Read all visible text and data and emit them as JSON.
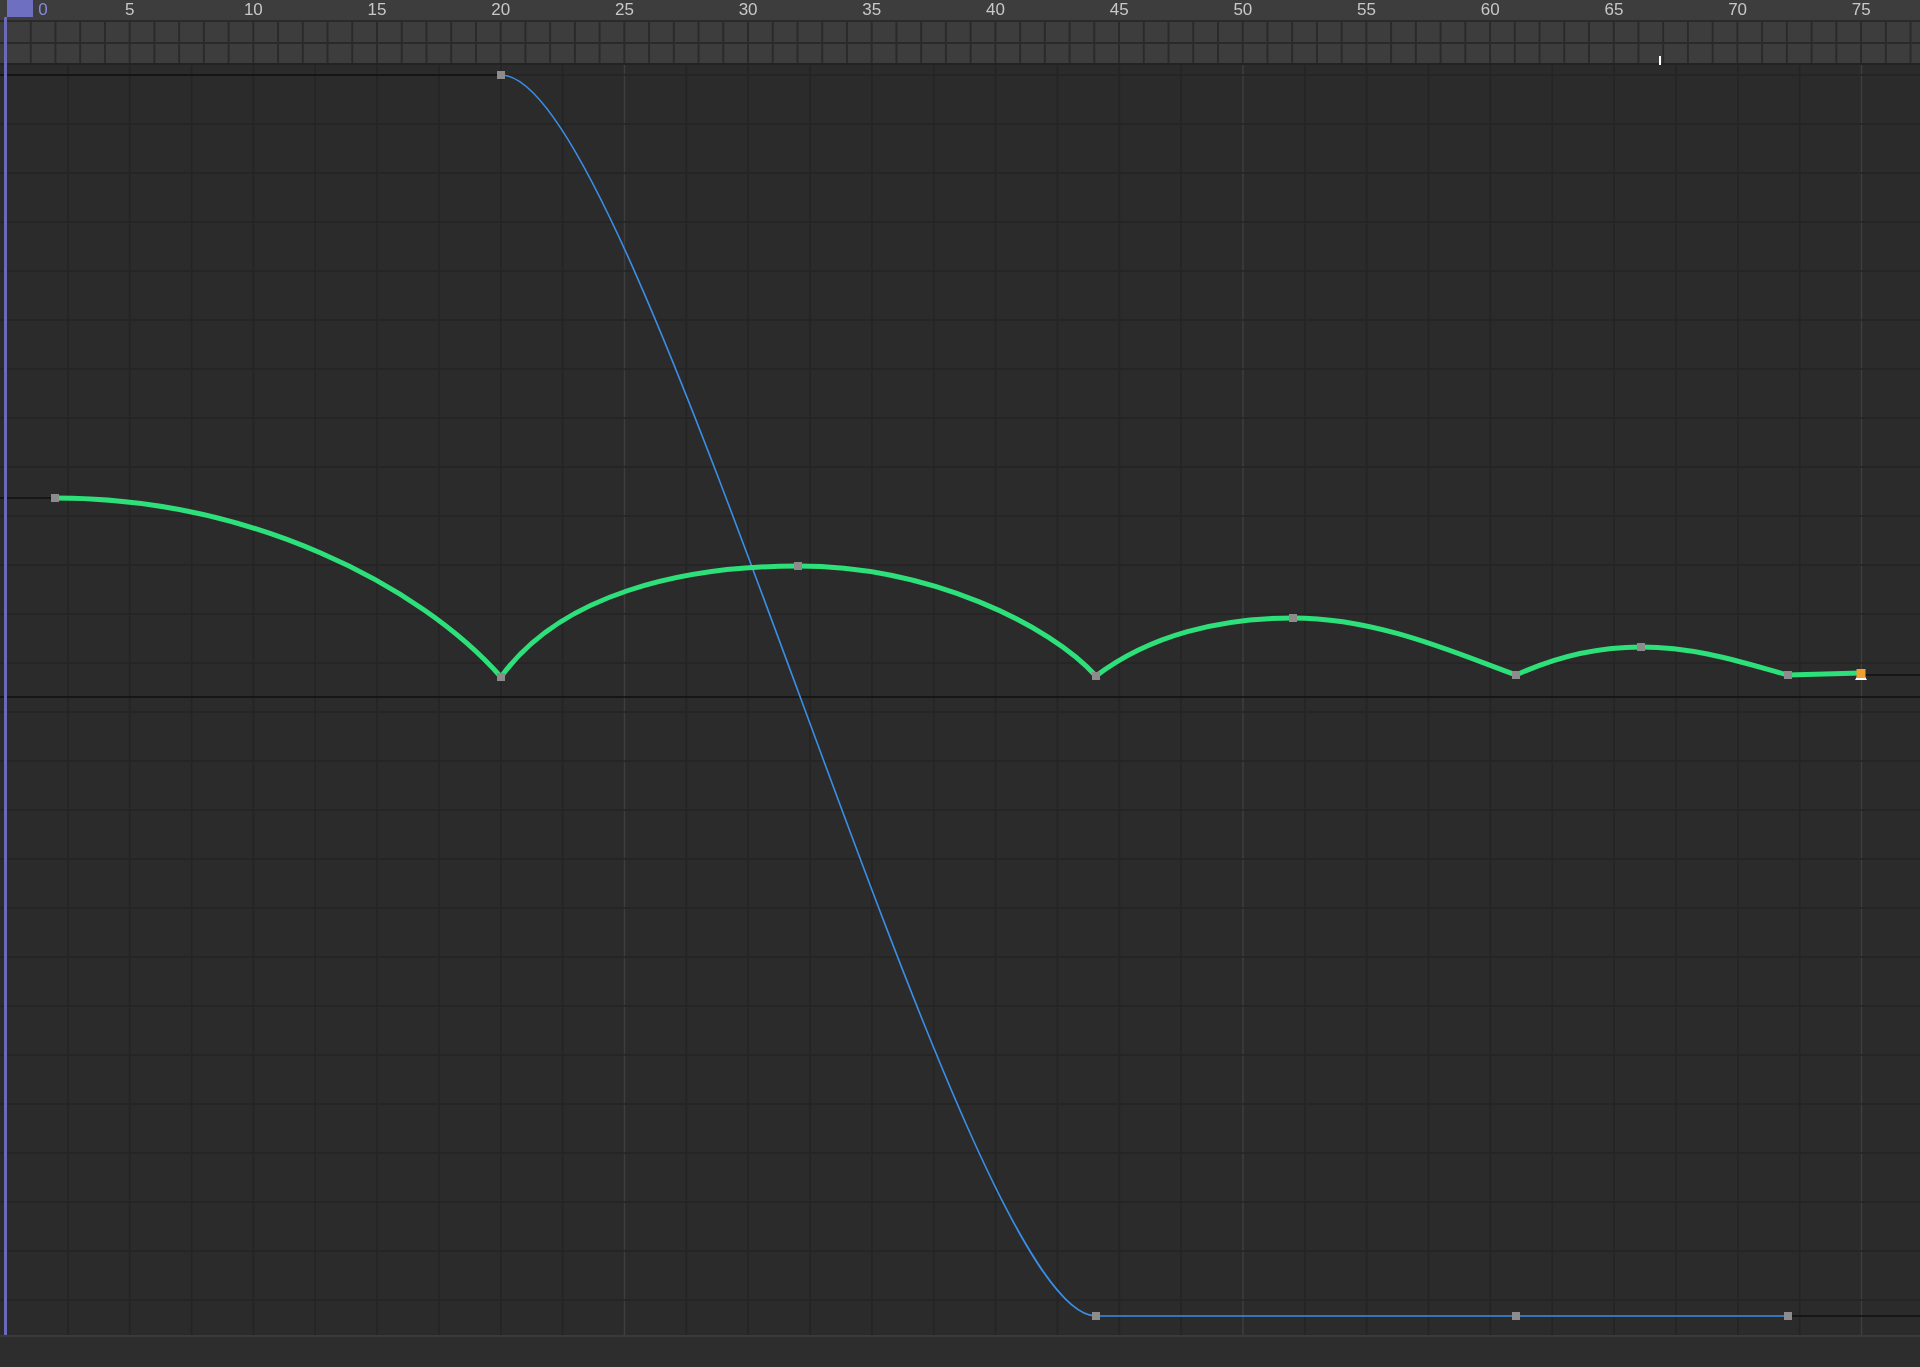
{
  "ruler": {
    "labels": [
      {
        "text": "0",
        "selected": true
      },
      {
        "text": "5",
        "selected": false
      },
      {
        "text": "10",
        "selected": false
      },
      {
        "text": "15",
        "selected": false
      },
      {
        "text": "20",
        "selected": false
      },
      {
        "text": "25",
        "selected": false
      },
      {
        "text": "30",
        "selected": false
      },
      {
        "text": "35",
        "selected": false
      },
      {
        "text": "40",
        "selected": false
      },
      {
        "text": "45",
        "selected": false
      },
      {
        "text": "50",
        "selected": false
      },
      {
        "text": "55",
        "selected": false
      },
      {
        "text": "60",
        "selected": false
      },
      {
        "text": "65",
        "selected": false
      },
      {
        "text": "70",
        "selected": false
      },
      {
        "text": "75",
        "selected": false
      }
    ]
  },
  "curves": [
    {
      "color": "#3a8ee6",
      "selected": false,
      "keyframes": [
        {
          "selected": false
        },
        {
          "selected": false
        },
        {
          "selected": false
        },
        {
          "selected": false
        }
      ]
    },
    {
      "color": "#2ee07a",
      "selected": true,
      "keyframes": [
        {
          "selected": false
        },
        {
          "selected": false
        },
        {
          "selected": false
        },
        {
          "selected": false
        },
        {
          "selected": false
        },
        {
          "selected": false
        },
        {
          "selected": false
        },
        {
          "selected": false
        },
        {
          "selected": true
        }
      ]
    }
  ]
}
